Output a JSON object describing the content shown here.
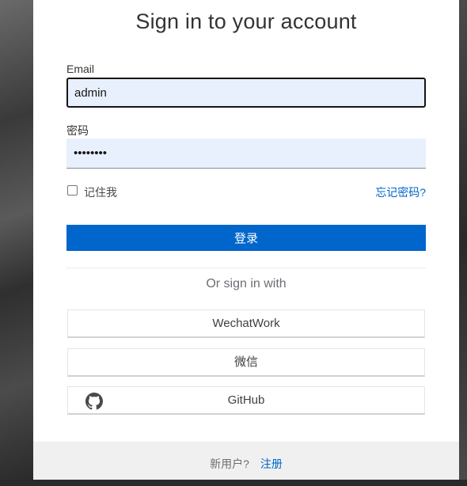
{
  "page": {
    "title": "Sign in to your account"
  },
  "form": {
    "email_label": "Email",
    "email_value": "admin",
    "password_label": "密码",
    "password_value": "••••••••",
    "remember_label": "记住我",
    "forgot_label": "忘记密码?",
    "login_label": "登录"
  },
  "social": {
    "title": "Or sign in with",
    "providers": [
      {
        "label": "WechatWork"
      },
      {
        "label": "微信"
      },
      {
        "label": "GitHub",
        "icon": "github-icon"
      }
    ]
  },
  "footer": {
    "new_user_text": "新用户?",
    "register_label": "注册"
  },
  "colors": {
    "primary": "#0066cc",
    "input_bg": "#e8f0fe"
  }
}
